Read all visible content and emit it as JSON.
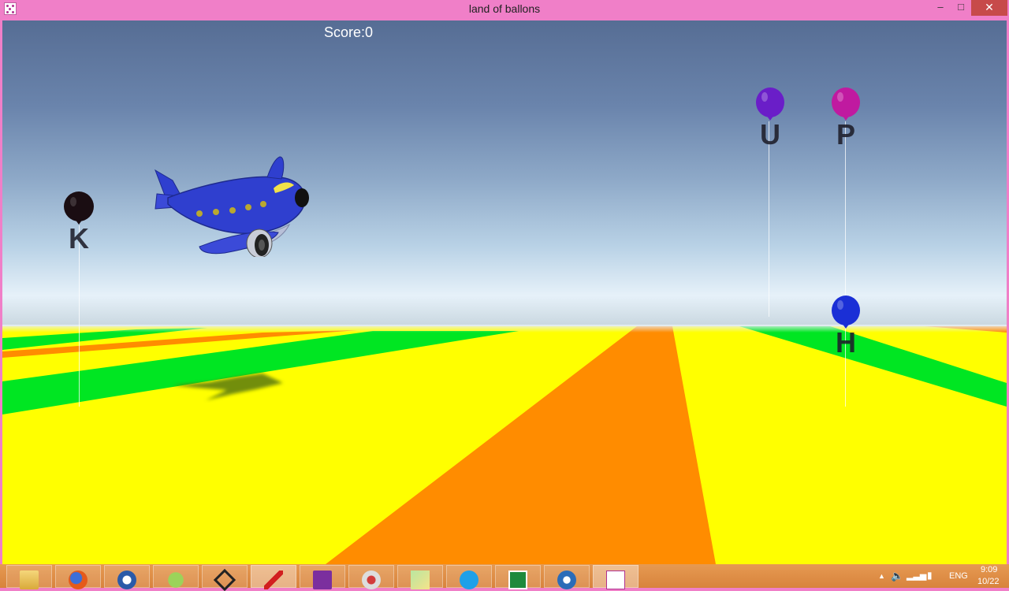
{
  "window": {
    "title": "land of ballons",
    "minimize_glyph": "‒",
    "maximize_glyph": "□",
    "close_glyph": "✕"
  },
  "hud": {
    "score_label": "Score:0"
  },
  "balloons": [
    {
      "letter": "K",
      "color": "#1a0d12"
    },
    {
      "letter": "U",
      "color": "#6a1ec8"
    },
    {
      "letter": "P",
      "color": "#c01aa0"
    },
    {
      "letter": "H",
      "color": "#1a2fd6"
    }
  ],
  "player": {
    "type": "airplane",
    "color": "#2f3fcf"
  },
  "taskbar": {
    "apps": [
      {
        "name": "file-explorer-icon"
      },
      {
        "name": "firefox-icon"
      },
      {
        "name": "media-player-icon"
      },
      {
        "name": "android-studio-icon"
      },
      {
        "name": "unity-icon"
      },
      {
        "name": "flash-icon",
        "active": true
      },
      {
        "name": "onenote-icon"
      },
      {
        "name": "snipping-tool-icon"
      },
      {
        "name": "sticky-notes-icon"
      },
      {
        "name": "skype-icon"
      },
      {
        "name": "calculator-icon"
      },
      {
        "name": "app-swirl-icon"
      },
      {
        "name": "game-app-icon"
      }
    ],
    "tray": {
      "language": "ENG",
      "time": "9:09",
      "date": "10/22"
    }
  },
  "colors": {
    "sky_top": "#566d94",
    "ground_yellow": "#ffff00",
    "ground_green": "#00e622",
    "ground_orange": "#ff8c00",
    "titlebar": "#f07fc8",
    "taskbar": "#e0893f"
  }
}
